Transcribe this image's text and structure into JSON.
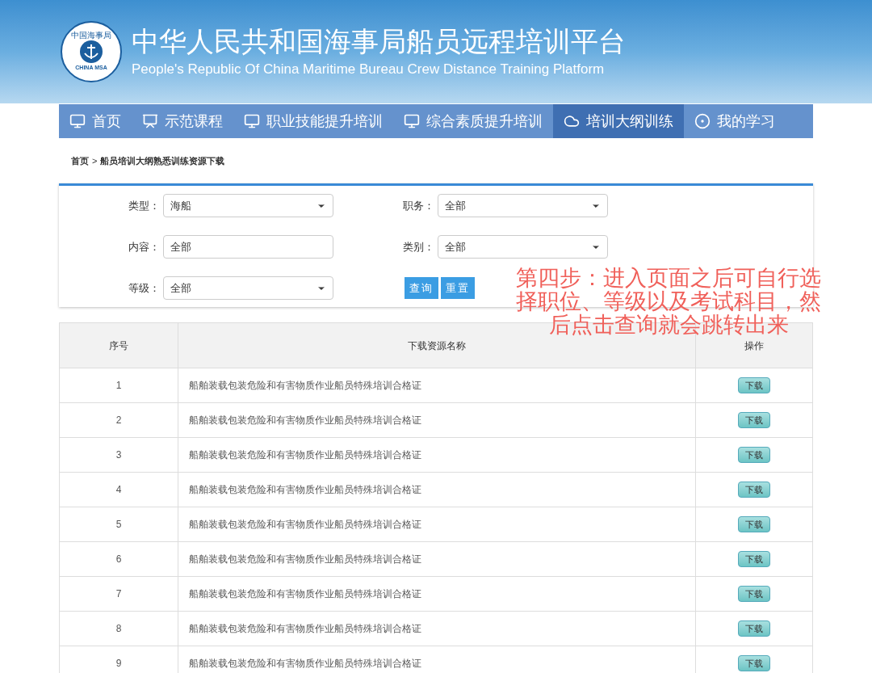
{
  "header": {
    "logo_top": "中国海事局",
    "logo_bottom": "CHINA MSA",
    "title": "中华人民共和国海事局船员远程培训平台",
    "subtitle": "People's Republic Of China Maritime Bureau Crew Distance Training Platform"
  },
  "nav": [
    {
      "label": "首页",
      "selected": false
    },
    {
      "label": "示范课程",
      "selected": false
    },
    {
      "label": "职业技能提升培训",
      "selected": false
    },
    {
      "label": "综合素质提升培训",
      "selected": false
    },
    {
      "label": "培训大纲训练",
      "selected": true
    },
    {
      "label": "我的学习",
      "selected": false
    }
  ],
  "breadcrumb": {
    "home": "首页",
    "separator": ">",
    "current": "船员培训大纲熟悉训练资源下载"
  },
  "filters": [
    {
      "label": "类型：",
      "kind": "select",
      "value": "海船"
    },
    {
      "label": "职务：",
      "kind": "select",
      "value": "全部"
    },
    {
      "label": "内容：",
      "kind": "input",
      "value": "全部"
    },
    {
      "label": "类别：",
      "kind": "select",
      "value": "全部"
    },
    {
      "label": "等级：",
      "kind": "select",
      "value": "全部"
    }
  ],
  "buttons": [
    "查询",
    "重置"
  ],
  "annotation": "第四步：进入页面之后可自行选择职位、等级以及考试科目，然后点击查询就会跳转出来",
  "table": {
    "columns": [
      "序号",
      "下载资源名称",
      "操作"
    ],
    "rows": [
      {
        "index": "1",
        "name": "船舶装载包装危险和有害物质作业船员特殊培训合格证",
        "action": "下载"
      },
      {
        "index": "2",
        "name": "船舶装载包装危险和有害物质作业船员特殊培训合格证",
        "action": "下载"
      },
      {
        "index": "3",
        "name": "船舶装载包装危险和有害物质作业船员特殊培训合格证",
        "action": "下载"
      },
      {
        "index": "4",
        "name": "船舶装载包装危险和有害物质作业船员特殊培训合格证",
        "action": "下载"
      },
      {
        "index": "5",
        "name": "船舶装载包装危险和有害物质作业船员特殊培训合格证",
        "action": "下载"
      },
      {
        "index": "6",
        "name": "船舶装载包装危险和有害物质作业船员特殊培训合格证",
        "action": "下载"
      },
      {
        "index": "7",
        "name": "船舶装载包装危险和有害物质作业船员特殊培训合格证",
        "action": "下载"
      },
      {
        "index": "8",
        "name": "船舶装载包装危险和有害物质作业船员特殊培训合格证",
        "action": "下载"
      },
      {
        "index": "9",
        "name": "船舶装载包装危险和有害物质作业船员特殊培训合格证",
        "action": "下载"
      }
    ]
  }
}
